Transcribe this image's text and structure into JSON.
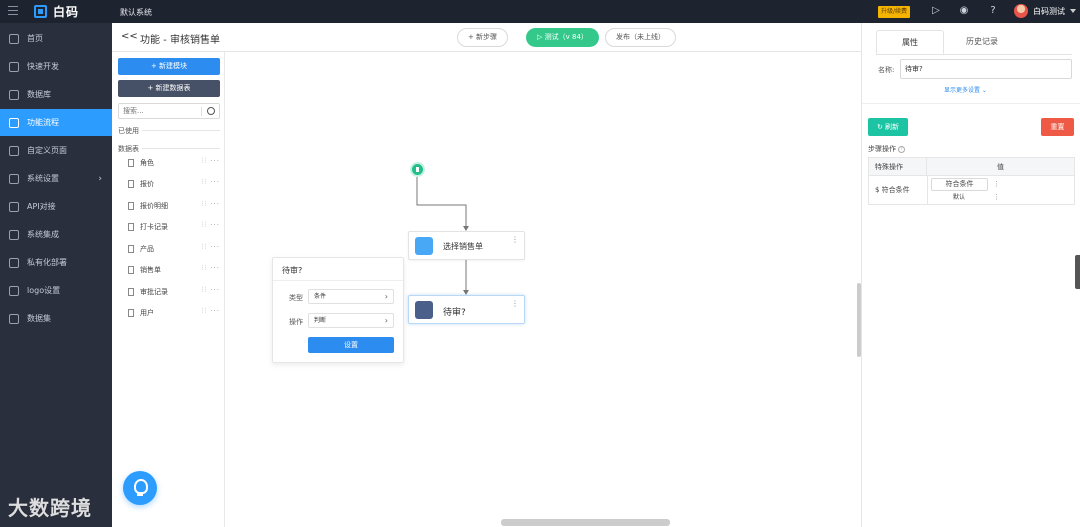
{
  "topbar": {
    "logo_text": "白码",
    "system_name": "默认系统",
    "upgrade_label": "升级/续费",
    "user_name": "白码测试"
  },
  "sidebar": {
    "items": [
      {
        "label": "首页"
      },
      {
        "label": "快速开发"
      },
      {
        "label": "数据库"
      },
      {
        "label": "功能流程"
      },
      {
        "label": "自定义页面"
      },
      {
        "label": "系统设置"
      },
      {
        "label": "API对接"
      },
      {
        "label": "系统集成"
      },
      {
        "label": "私有化部署"
      },
      {
        "label": "logo设置"
      },
      {
        "label": "数据集"
      }
    ]
  },
  "header": {
    "title": "功能 - 审核销售单",
    "new_step": "+ 新步骤",
    "test": "▷ 测试（v 84）",
    "publish": "发布（未上线）"
  },
  "modpanel": {
    "new_module": "+ 新建模块",
    "new_table": "+ 新建数据表",
    "search_placeholder": "搜索...",
    "used_label": "已使用",
    "tables_label": "数据表",
    "items": [
      {
        "label": "角色"
      },
      {
        "label": "报价"
      },
      {
        "label": "报价明细"
      },
      {
        "label": "打卡记录"
      },
      {
        "label": "产品"
      },
      {
        "label": "销售单"
      },
      {
        "label": "审批记录"
      },
      {
        "label": "用户"
      }
    ]
  },
  "flow": {
    "node1_label": "选择销售单",
    "node2_label": "待审?",
    "popup": {
      "title": "待审?",
      "type_label": "类型",
      "type_value": "条件",
      "op_label": "操作",
      "op_value": "判断",
      "button": "设置"
    }
  },
  "rpanel": {
    "tab_properties": "属性",
    "tab_history": "历史记录",
    "name_label": "名称:",
    "name_value": "待审?",
    "more_settings": "显示更多设置",
    "refresh": "刷新",
    "reset": "重置",
    "step_ops": "步骤操作",
    "table": {
      "col1": "特殊操作",
      "col2": "值",
      "row_label": "$ 符合条件",
      "chip": "符合条件",
      "default": "默认"
    }
  },
  "watermark": "大数跨境",
  "colors": {
    "accent": "#2d9cff",
    "test_green": "#34c98b",
    "reset_red": "#ee5a45",
    "refresh_teal": "#1cc4a3",
    "sidebar_bg": "#2a2f3d"
  }
}
